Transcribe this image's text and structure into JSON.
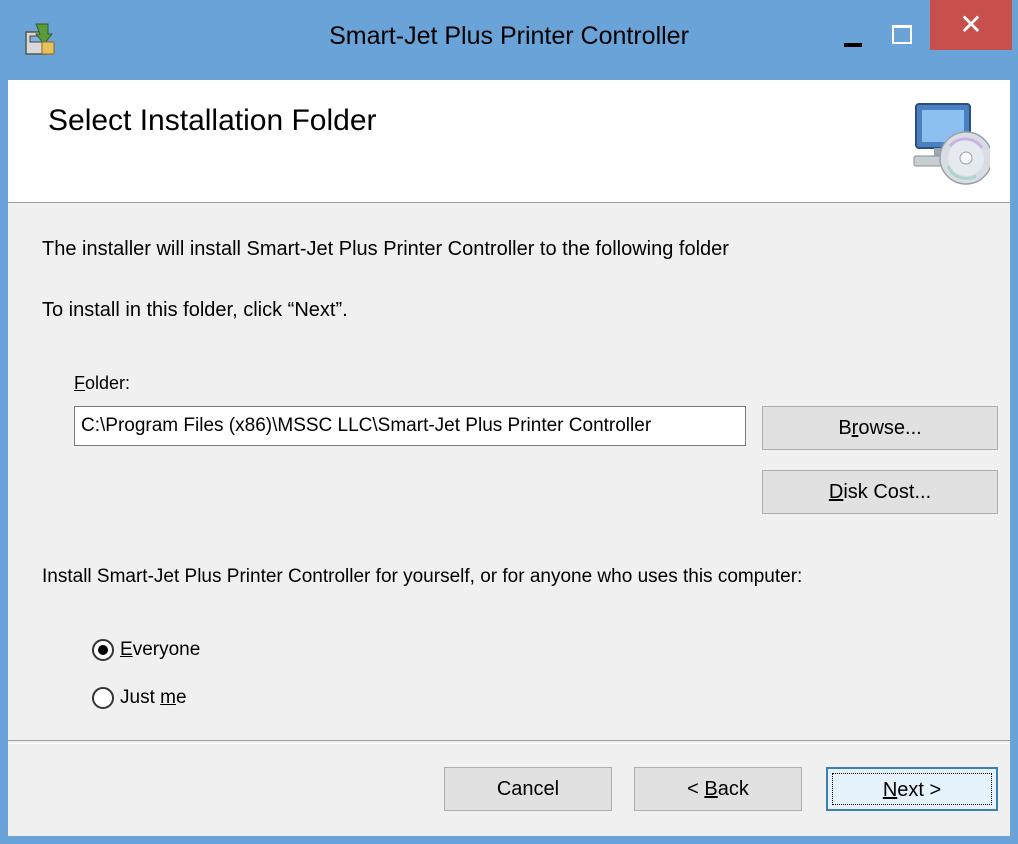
{
  "window": {
    "title": "Smart-Jet Plus Printer Controller",
    "close_glyph": "✕"
  },
  "header": {
    "title": "Select Installation Folder"
  },
  "body": {
    "intro_line": "The installer will install Smart-Jet Plus Printer Controller to the following folder",
    "instruction_line": "To install in this folder, click “Next”.",
    "folder_label_mnemonic": "F",
    "folder_label_rest": "older:",
    "folder_value": "C:\\Program Files (x86)\\MSSC LLC\\Smart-Jet Plus Printer Controller",
    "browse_pre": "B",
    "browse_mnemonic": "r",
    "browse_post": "owse...",
    "diskcost_mnemonic": "D",
    "diskcost_post": "isk Cost...",
    "install_for_text": "Install Smart-Jet Plus Printer Controller for yourself, or for anyone who uses this computer:",
    "options": [
      {
        "mnemonic": "E",
        "rest": "veryone",
        "selected": true
      },
      {
        "pre": "Just ",
        "mnemonic": "m",
        "rest": "e",
        "selected": false
      }
    ]
  },
  "footer": {
    "cancel_label": "Cancel",
    "back_pre": "< ",
    "back_mnemonic": "B",
    "back_post": "ack",
    "next_mnemonic": "N",
    "next_post": "ext >"
  },
  "colors": {
    "titlebar": "#6aa3d8",
    "close": "#c7504d",
    "background": "#f0f0f0"
  }
}
